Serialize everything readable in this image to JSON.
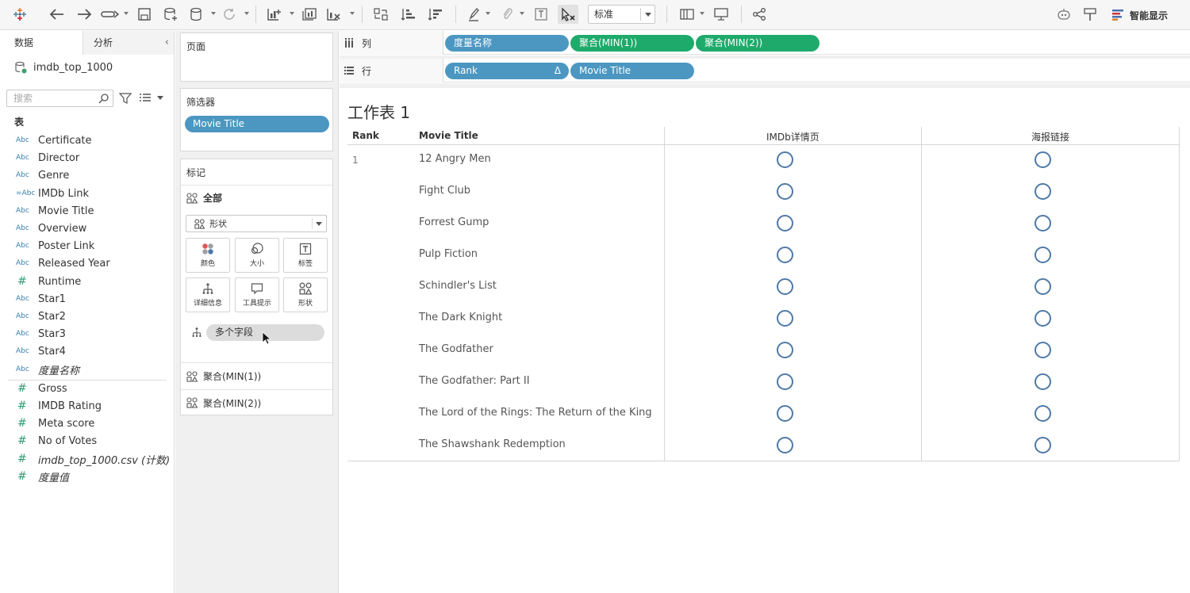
{
  "toolbar": {
    "fit_value": "标准",
    "show_me_label": "智能显示",
    "icons": [
      "tableau-logo-icon",
      "undo-icon",
      "redo-icon",
      "forward-icon",
      "save-icon",
      "new-datasource-icon",
      "datasource-icon",
      "refresh-icon",
      "new-worksheet-icon",
      "duplicate-sheet-icon",
      "clear-sheet-icon",
      "swap-icon",
      "sort-ascending-icon",
      "sort-descending-icon",
      "highlight-icon",
      "group-icon",
      "label-icon",
      "fix-axes-icon",
      "show-cards-icon",
      "presentation-icon",
      "share-icon",
      "bot-icon",
      "pin-icon",
      "show-me-icon"
    ]
  },
  "data_pane": {
    "tabs": [
      "数据",
      "分析"
    ],
    "datasource": "imdb_top_1000",
    "search_placeholder": "搜索",
    "tables_heading": "表",
    "dimensions": [
      {
        "type": "Abc",
        "name": "Certificate"
      },
      {
        "type": "Abc",
        "name": "Director"
      },
      {
        "type": "Abc",
        "name": "Genre"
      },
      {
        "type": "=Abc",
        "name": "IMDb Link"
      },
      {
        "type": "Abc",
        "name": "Movie Title"
      },
      {
        "type": "Abc",
        "name": "Overview"
      },
      {
        "type": "Abc",
        "name": "Poster Link"
      },
      {
        "type": "Abc",
        "name": "Released Year"
      },
      {
        "type": "#",
        "name": "Runtime"
      },
      {
        "type": "Abc",
        "name": "Star1"
      },
      {
        "type": "Abc",
        "name": "Star2"
      },
      {
        "type": "Abc",
        "name": "Star3"
      },
      {
        "type": "Abc",
        "name": "Star4"
      },
      {
        "type": "Abc",
        "name": "度量名称"
      }
    ],
    "measures": [
      {
        "type": "#",
        "name": "Gross"
      },
      {
        "type": "#",
        "name": "IMDB Rating"
      },
      {
        "type": "#",
        "name": "Meta score"
      },
      {
        "type": "#",
        "name": "No of Votes"
      },
      {
        "type": "#",
        "name": "imdb_top_1000.csv (计数)"
      },
      {
        "type": "#",
        "name": "度量值"
      }
    ]
  },
  "cards": {
    "pages_title": "页面",
    "filters_title": "筛选器",
    "filter_pill": "Movie Title",
    "marks_title": "标记",
    "marks_all": "全部",
    "mark_type": "形状",
    "buttons": [
      "颜色",
      "大小",
      "标签",
      "详细信息",
      "工具提示",
      "形状"
    ],
    "multi_field": "多个字段",
    "agg1": "聚合(MIN(1))",
    "agg2": "聚合(MIN(2))"
  },
  "shelves": {
    "columns_label": "列",
    "rows_label": "行",
    "column_pills": [
      "度量名称",
      "聚合(MIN(1))",
      "聚合(MIN(2))"
    ],
    "row_pills": [
      "Rank",
      "Movie Title"
    ],
    "rank_sort_icon": "Δ"
  },
  "sheet": {
    "title": "工作表 1",
    "headers": {
      "rank": "Rank",
      "movie_title": "Movie Title",
      "col1": "IMDb详情页",
      "col2": "海报链接"
    },
    "rank_value": "1",
    "movies": [
      "12 Angry Men",
      "Fight Club",
      "Forrest Gump",
      "Pulp Fiction",
      "Schindler's List",
      "The Dark Knight",
      "The Godfather",
      "The Godfather: Part II",
      "The Lord of the Rings: The Return of the King",
      "The Shawshank Redemption"
    ],
    "mark_color": "#4e79a7"
  }
}
